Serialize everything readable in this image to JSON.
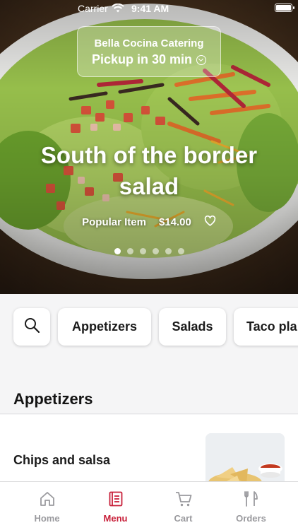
{
  "status_bar": {
    "carrier": "Carrier",
    "time": "9:41 AM"
  },
  "header": {
    "restaurant": "Bella Cocina Catering",
    "pickup": "Pickup in 30 min"
  },
  "hero": {
    "title": "South of the border salad",
    "tag": "Popular Item",
    "price": "$14.00",
    "dots_count": 6,
    "active_dot": 0
  },
  "categories": {
    "search_icon": "search-icon",
    "items": [
      "Appetizers",
      "Salads",
      "Taco pla"
    ]
  },
  "section": {
    "title": "Appetizers"
  },
  "menu_items": [
    {
      "name": "Chips and salsa"
    }
  ],
  "tab_bar": {
    "tabs": [
      {
        "label": "Home",
        "icon": "home-icon"
      },
      {
        "label": "Menu",
        "icon": "menu-icon"
      },
      {
        "label": "Cart",
        "icon": "cart-icon"
      },
      {
        "label": "Orders",
        "icon": "orders-icon"
      }
    ],
    "active": "Menu",
    "active_color": "#c8203a",
    "inactive_color": "#9a9a9e"
  }
}
